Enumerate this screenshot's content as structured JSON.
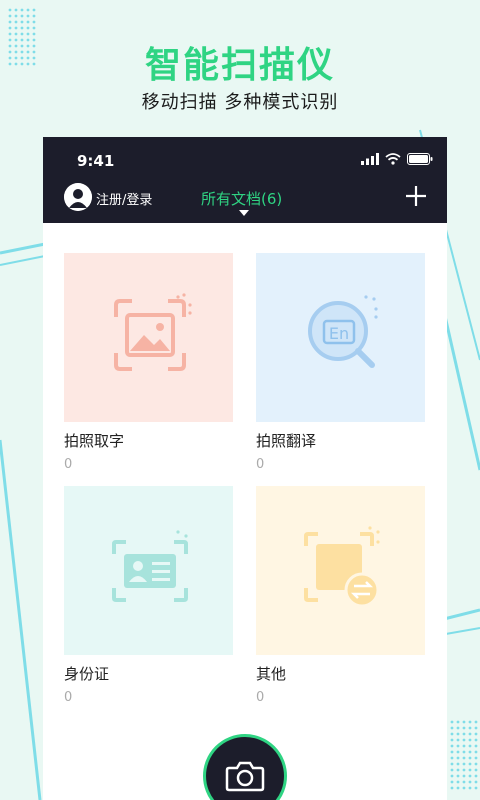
{
  "banner": {
    "title": "智能扫描仪",
    "subtitle": "移动扫描 多种模式识别"
  },
  "status_bar": {
    "time": "9:41"
  },
  "top_bar": {
    "login_label": "注册/登录",
    "active_tab_label": "所有文档(6)"
  },
  "cards": [
    {
      "title": "拍照取字",
      "count": "0",
      "icon": "image-scan-icon",
      "bg": "#fde8e3"
    },
    {
      "title": "拍照翻译",
      "count": "0",
      "icon": "translate-search-icon",
      "bg": "#e3f1fc"
    },
    {
      "title": "身份证",
      "count": "0",
      "icon": "id-card-scan-icon",
      "bg": "#e6f8f6"
    },
    {
      "title": "其他",
      "count": "0",
      "icon": "document-swap-icon",
      "bg": "#fff6e3"
    }
  ],
  "colors": {
    "accent": "#2fd483",
    "dark_bar": "#1c1d2b",
    "background": "#e9f8f3"
  }
}
